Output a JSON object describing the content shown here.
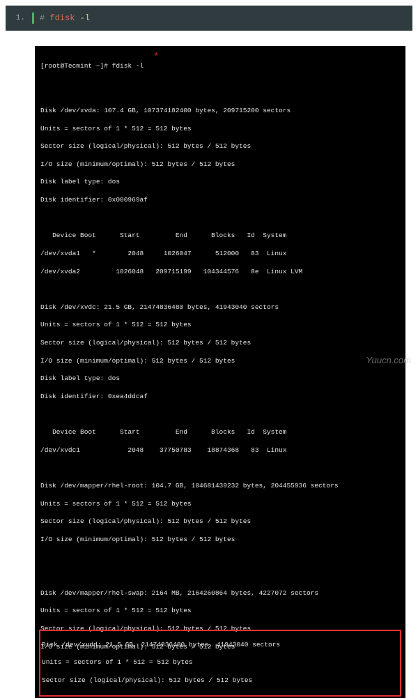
{
  "code_block": {
    "line_number": "1.",
    "hash": "# ",
    "command": "fdisk",
    "flag": " -l"
  },
  "terminal": {
    "prompt": "[root@Tecmint ~]# fdisk -l",
    "red_dot": "*",
    "disks": [
      {
        "header": "Disk /dev/xvda: 107.4 GB, 107374182400 bytes, 209715200 sectors",
        "units": "Units = sectors of 1 * 512 = 512 bytes",
        "sector": "Sector size (logical/physical): 512 bytes / 512 bytes",
        "io": "I/O size (minimum/optimal): 512 bytes / 512 bytes",
        "label": "Disk label type: dos",
        "identifier": "Disk identifier: 0x000969af"
      }
    ],
    "partition_header_1": "   Device Boot      Start         End      Blocks   Id  System",
    "partitions_1": [
      "/dev/xvda1   *        2048     1026047      512000   83  Linux",
      "/dev/xvda2         1026048   209715199   104344576   8e  Linux LVM"
    ],
    "disk2": {
      "header": "Disk /dev/xvdc: 21.5 GB, 21474836480 bytes, 41943040 sectors",
      "units": "Units = sectors of 1 * 512 = 512 bytes",
      "sector": "Sector size (logical/physical): 512 bytes / 512 bytes",
      "io": "I/O size (minimum/optimal): 512 bytes / 512 bytes",
      "label": "Disk label type: dos",
      "identifier": "Disk identifier: 0xea4ddcaf"
    },
    "partition_header_2": "   Device Boot      Start         End      Blocks   Id  System",
    "partitions_2": [
      "/dev/xvdc1            2048    37750783    18874368   83  Linux"
    ],
    "disk3": {
      "header": "Disk /dev/mapper/rhel-root: 104.7 GB, 104681439232 bytes, 204455936 sectors",
      "units": "Units = sectors of 1 * 512 = 512 bytes",
      "sector": "Sector size (logical/physical): 512 bytes / 512 bytes",
      "io": "I/O size (minimum/optimal): 512 bytes / 512 bytes"
    },
    "disk4": {
      "header": "Disk /dev/mapper/rhel-swap: 2164 MB, 2164260864 bytes, 4227072 sectors",
      "units": "Units = sectors of 1 * 512 = 512 bytes",
      "sector": "Sector size (logical/physical): 512 bytes / 512 bytes",
      "io": "I/O size (minimum/optimal): 512 bytes / 512 bytes"
    },
    "highlighted": {
      "header": "Disk /dev/xvdd: 21.5 GB, 21474836480 bytes, 41943040 sectors",
      "units": "Units = sectors of 1 * 512 = 512 bytes",
      "sector": "Sector size (logical/physical): 512 bytes / 512 bytes"
    }
  },
  "watermark": "Yuucn.com"
}
